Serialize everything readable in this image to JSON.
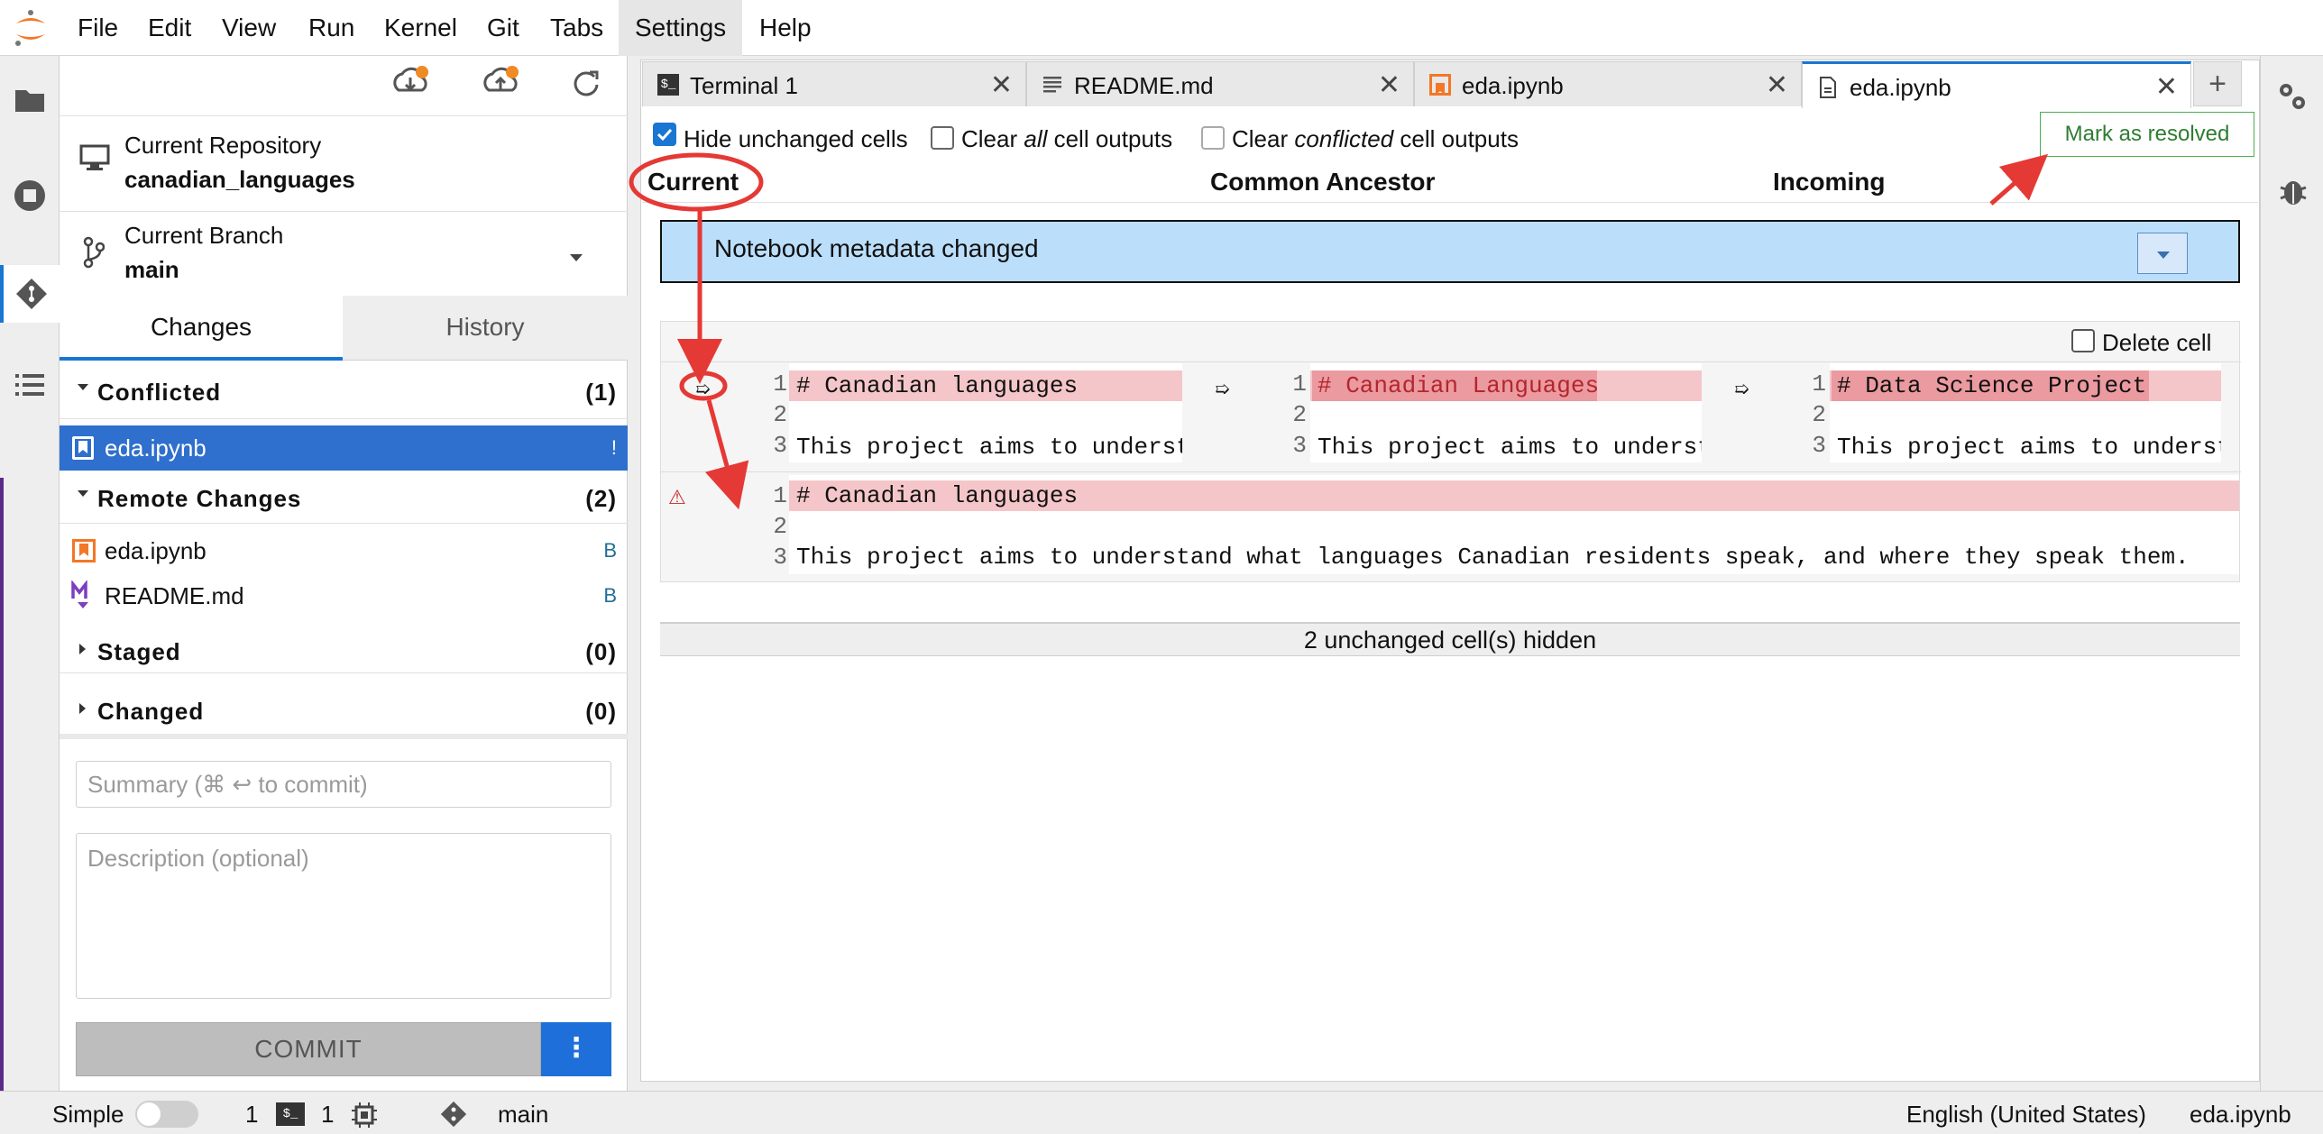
{
  "menubar": {
    "items": [
      "File",
      "Edit",
      "View",
      "Run",
      "Kernel",
      "Git",
      "Tabs",
      "Settings",
      "Help"
    ],
    "active": "Settings"
  },
  "git_panel": {
    "repo_label": "Current Repository",
    "repo_name": "canadian_languages",
    "branch_label": "Current Branch",
    "branch_name": "main",
    "tabs": [
      "Changes",
      "History"
    ],
    "sections": {
      "conflicted": {
        "title": "Conflicted",
        "count": "(1)",
        "files": [
          {
            "name": "eda.ipynb",
            "status": "!"
          }
        ]
      },
      "remote": {
        "title": "Remote Changes",
        "count": "(2)",
        "files": [
          {
            "name": "eda.ipynb",
            "status": "B"
          },
          {
            "name": "README.md",
            "status": "B"
          }
        ]
      },
      "staged": {
        "title": "Staged",
        "count": "(0)"
      },
      "changed": {
        "title": "Changed",
        "count": "(0)"
      }
    },
    "summary_placeholder": "Summary (⌘ ↩ to commit)",
    "description_placeholder": "Description (optional)",
    "commit_label": "COMMIT",
    "commit_menu_icon": "⋮"
  },
  "tabs": [
    {
      "label": "Terminal 1",
      "icon": "terminal-icon"
    },
    {
      "label": "README.md",
      "icon": "markdown-icon"
    },
    {
      "label": "eda.ipynb",
      "icon": "notebook-icon"
    },
    {
      "label": "eda.ipynb",
      "icon": "file-icon",
      "active": true
    }
  ],
  "tab_add": "+",
  "merge": {
    "options": {
      "hide_unchanged": "Hide unchanged cells",
      "clear_all_pre": "Clear ",
      "clear_all_em": "all",
      "clear_all_post": " cell outputs",
      "clear_conflicted_pre": "Clear ",
      "clear_conflicted_em": "conflicted",
      "clear_conflicted_post": " cell outputs"
    },
    "resolve_label": "Mark as resolved",
    "columns": [
      "Current",
      "Common Ancestor",
      "Incoming"
    ],
    "metadata_label": "Notebook metadata changed",
    "delete_cell_label": "Delete cell",
    "cell_current": [
      "# Canadian languages",
      "",
      "This project aims to underst"
    ],
    "cell_ancestor": [
      "# Canadian Languages",
      "",
      "This project aims to underst"
    ],
    "cell_incoming": [
      "# Data Science Project",
      "",
      "This project aims to underst"
    ],
    "cell_merged": [
      "# Canadian languages",
      "",
      "This project aims to understand what languages Canadian residents speak, and where they speak them."
    ],
    "line_numbers": [
      "1",
      "2",
      "3"
    ],
    "picker_glyph": "➯",
    "warning_glyph": "⚠",
    "hidden_label": "2 unchanged cell(s) hidden"
  },
  "statusbar": {
    "mode": "Simple",
    "terminals": "1",
    "kernels": "1",
    "branch": "main",
    "language": "English (United States)",
    "file": "eda.ipynb"
  },
  "colors": {
    "accent": "#1976d2",
    "annotation": "#e53935",
    "resolve_green": "#2e7d32",
    "deleted_bg": "#f5c6c9",
    "metadata_bg": "#bbdefb"
  }
}
